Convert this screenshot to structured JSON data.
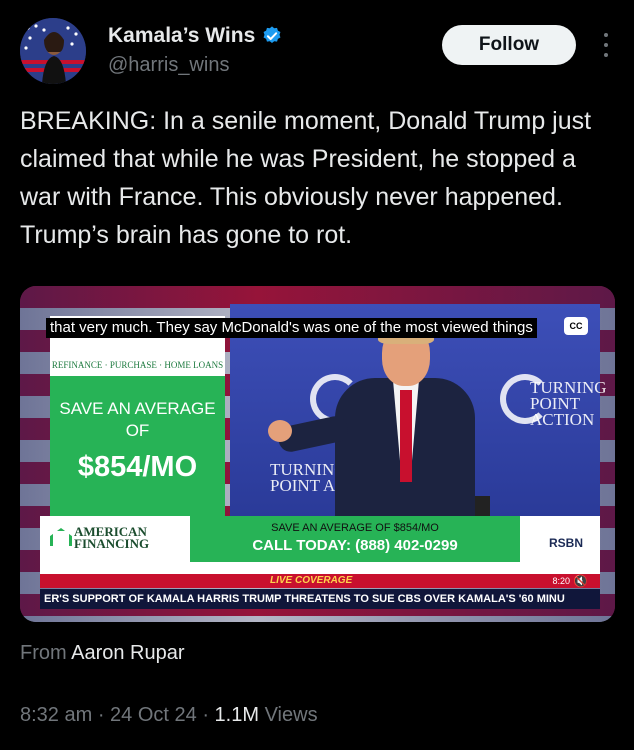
{
  "author": {
    "name": "Kamala’s Wins",
    "handle": "@harris_wins",
    "verified": true
  },
  "follow_label": "Follow",
  "tweet": {
    "text": "BREAKING: In a senile moment, Donald Trump just claimed that while he was President, he stopped a war with France. This obviously never happened. Trump’s brain has gone to rot."
  },
  "video": {
    "caption": "that very much. They say McDonald's was one of the most viewed things",
    "cc_label": "CC",
    "ad": {
      "save_label": "SAVE AN AVERAGE OF",
      "price": "$854/MO",
      "logo_text": "REFINANCE · PURCHASE · HOME LOANS"
    },
    "stage_texts": [
      "TURNING POINT ACTION",
      "TURNING POINT AC"
    ],
    "lower_third": {
      "logo": "AMERICAN FINANCING",
      "offer": "SAVE AN AVERAGE OF $854/MO",
      "call": "CALL TODAY: (888) 402-0299",
      "network": "RSBN"
    },
    "live_label": "LIVE COVERAGE",
    "time": "8:20",
    "ticker": "ER'S SUPPORT OF KAMALA HARRIS   TRUMP THREATENS TO SUE CBS OVER KAMALA'S '60 MINU"
  },
  "source": {
    "prefix": "From",
    "author": "Aaron Rupar"
  },
  "meta": {
    "time": "8:32 am",
    "date": "24 Oct 24",
    "views_count": "1.1M",
    "views_label": "Views"
  },
  "colors": {
    "background": "#000000",
    "primary_text": "#e7e9ea",
    "secondary_text": "#71767b",
    "verified_blue": "#1d9bf0",
    "follow_bg": "#eff3f4"
  }
}
